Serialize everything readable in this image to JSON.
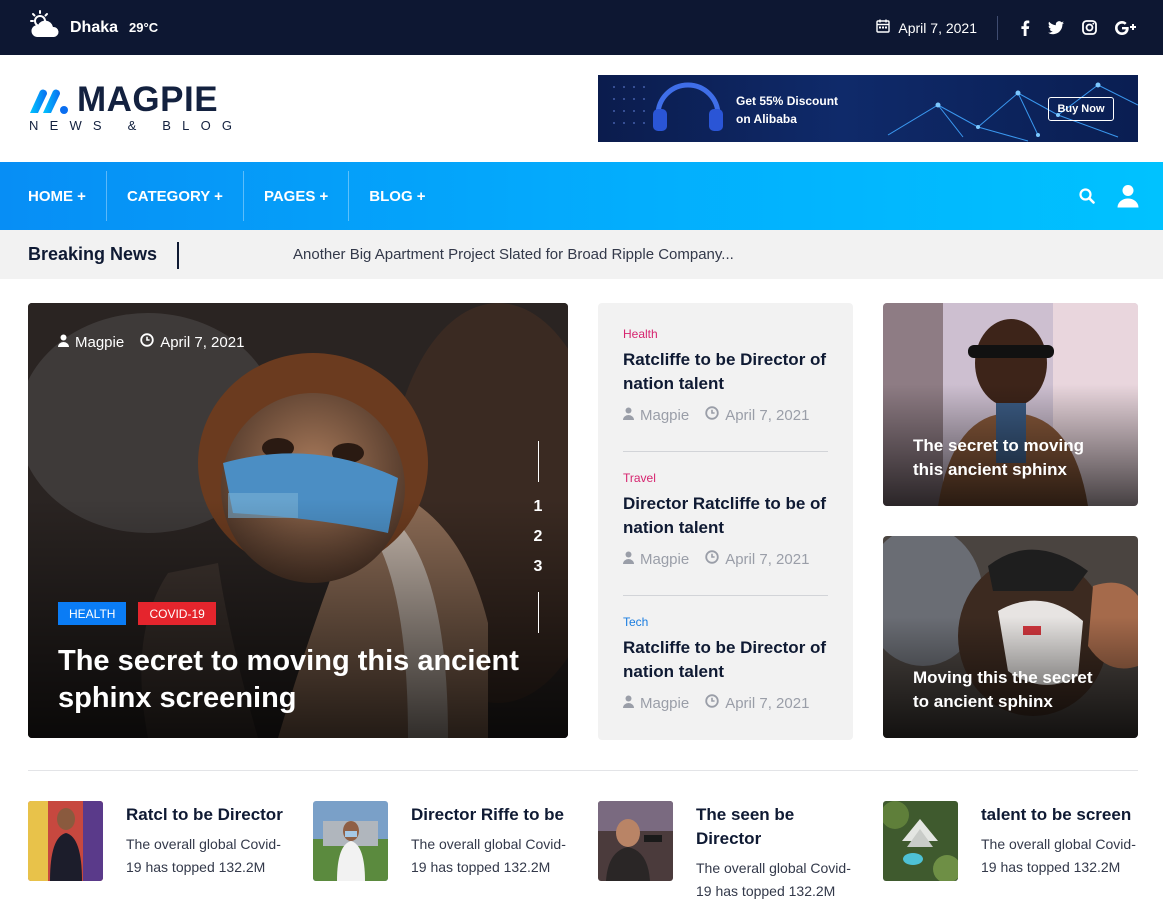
{
  "topbar": {
    "weather_city": "Dhaka",
    "weather_temp": "29°C",
    "date": "April 7, 2021",
    "socials": [
      "facebook-icon",
      "twitter-icon",
      "instagram-icon",
      "google-plus-icon"
    ]
  },
  "logo": {
    "name": "MAGPIE",
    "tagline": "NEWS & BLOG"
  },
  "ad": {
    "line1": "Get 55% Discount",
    "line2": "on Alibaba",
    "button": "Buy Now"
  },
  "nav": {
    "items": [
      {
        "label": "HOME +"
      },
      {
        "label": "CATEGORY +"
      },
      {
        "label": "PAGES +"
      },
      {
        "label": "BLOG +"
      }
    ]
  },
  "breaking": {
    "label": "Breaking News",
    "headline": "Another Big Apartment Project Slated for Broad Ripple Company..."
  },
  "hero": {
    "author": "Magpie",
    "date": "April 7, 2021",
    "tags": [
      {
        "label": "HEALTH",
        "color": "#0a7cf5"
      },
      {
        "label": "COVID-19",
        "color": "#e5252d"
      }
    ],
    "title": "The secret to moving this ancient sphinx screening",
    "pages": [
      "1",
      "2",
      "3"
    ]
  },
  "mid_list": [
    {
      "category": "Health",
      "category_color": "#d6246f",
      "title": "Ratcliffe to be Director of nation talent",
      "author": "Magpie",
      "date": "April 7, 2021"
    },
    {
      "category": "Travel",
      "category_color": "#d6246f",
      "title": "Director Ratcliffe to be of nation talent",
      "author": "Magpie",
      "date": "April 7, 2021"
    },
    {
      "category": "Tech",
      "category_color": "#1a7de0",
      "title": "Ratcliffe to be Director of nation talent",
      "author": "Magpie",
      "date": "April 7, 2021"
    }
  ],
  "side_cards": [
    {
      "title": "The secret to moving this ancient sphinx"
    },
    {
      "title": "Moving this the secret to ancient sphinx"
    }
  ],
  "bottom": [
    {
      "title": "Ratcl to be Director",
      "excerpt": "The overall global Covid-19 has topped 132.2M"
    },
    {
      "title": "Director Riffe to be",
      "excerpt": "The overall global Covid-19 has topped 132.2M"
    },
    {
      "title": "The seen be Director",
      "excerpt": "The overall global Covid-19 has topped 132.2M"
    },
    {
      "title": "talent to be screen",
      "excerpt": "The overall global Covid-19 has topped 132.2M"
    }
  ]
}
